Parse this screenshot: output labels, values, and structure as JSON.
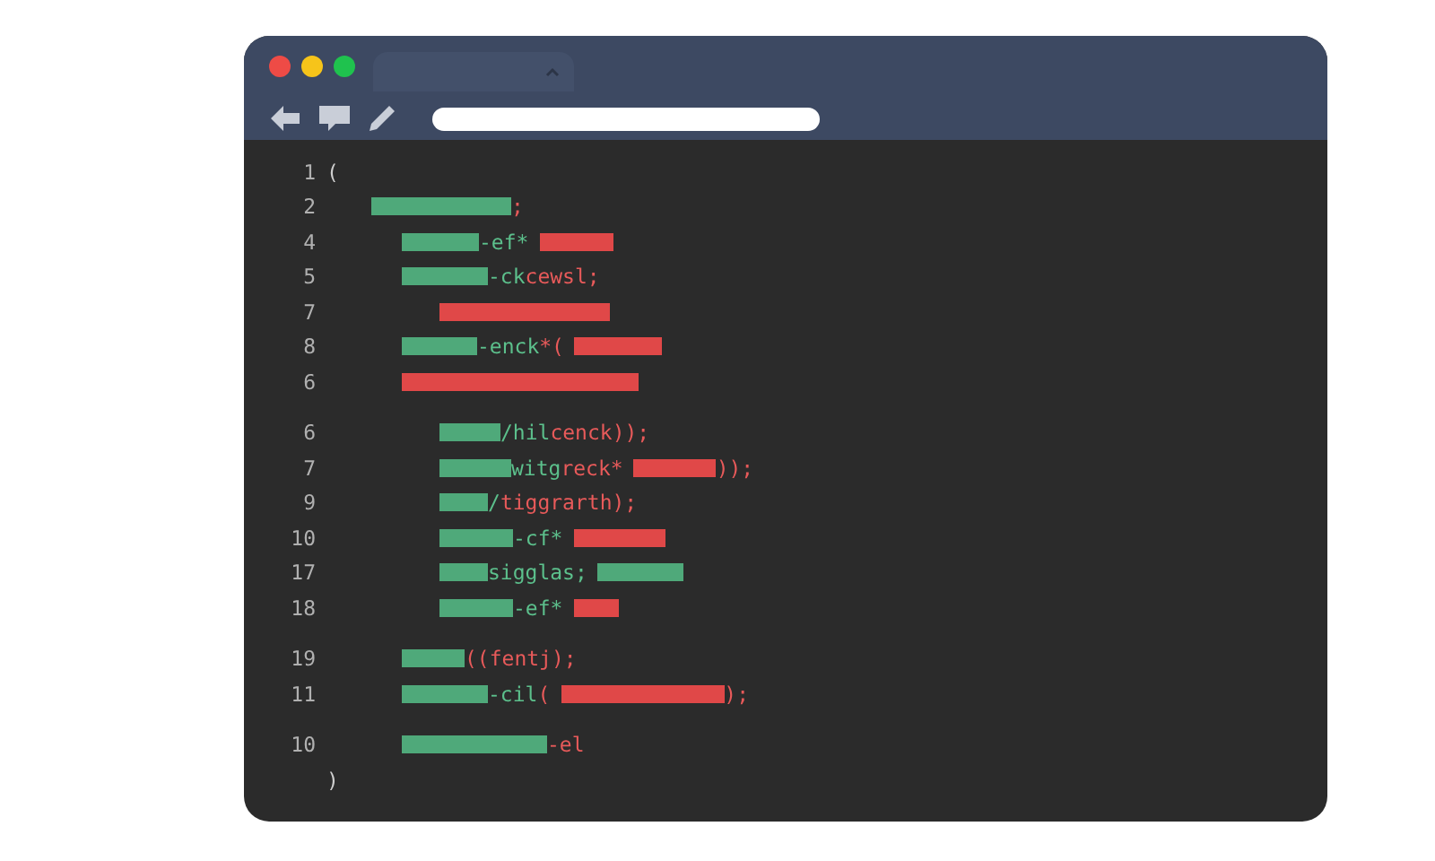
{
  "editor": {
    "lines": [
      {
        "number": "1",
        "parts": [
          {
            "kind": "text",
            "color": "#cfcfcf",
            "text": "("
          }
        ]
      },
      {
        "number": "2",
        "parts": [
          {
            "kind": "bar",
            "color": "#4fa97a"
          },
          {
            "kind": "text",
            "color": "#e85a5a",
            "text": ";"
          }
        ]
      },
      {
        "number": "4",
        "parts": [
          {
            "kind": "bar",
            "color": "#4fa97a"
          },
          {
            "kind": "text",
            "color": "#5cc08c",
            "text": "-ef*"
          },
          {
            "kind": "bar",
            "color": "#e04848"
          }
        ]
      },
      {
        "number": "5",
        "parts": [
          {
            "kind": "bar",
            "color": "#4fa97a"
          },
          {
            "kind": "text",
            "color": "#5cc08c",
            "text": "-ck"
          },
          {
            "kind": "text",
            "color": "#e85a5a",
            "text": "cewsl;"
          }
        ]
      },
      {
        "number": "7",
        "parts": [
          {
            "kind": "bar",
            "color": "#e04848"
          }
        ]
      },
      {
        "number": "8",
        "parts": [
          {
            "kind": "bar",
            "color": "#4fa97a"
          },
          {
            "kind": "text",
            "color": "#5cc08c",
            "text": "-enck"
          },
          {
            "kind": "text",
            "color": "#e85a5a",
            "text": "*("
          },
          {
            "kind": "bar",
            "color": "#e04848"
          }
        ]
      },
      {
        "number": "6",
        "parts": [
          {
            "kind": "bar",
            "color": "#e04848"
          }
        ]
      },
      {
        "number": "6",
        "parts": [
          {
            "kind": "bar",
            "color": "#4fa97a"
          },
          {
            "kind": "text",
            "color": "#5cc08c",
            "text": "/hil"
          },
          {
            "kind": "text",
            "color": "#e85a5a",
            "text": "cenck));"
          }
        ]
      },
      {
        "number": "7",
        "parts": [
          {
            "kind": "bar",
            "color": "#4fa97a"
          },
          {
            "kind": "text",
            "color": "#5cc08c",
            "text": "witg"
          },
          {
            "kind": "text",
            "color": "#e85a5a",
            "text": "reck*"
          },
          {
            "kind": "bar",
            "color": "#e04848"
          },
          {
            "kind": "text",
            "color": "#e85a5a",
            "text": "));"
          }
        ]
      },
      {
        "number": "9",
        "parts": [
          {
            "kind": "bar",
            "color": "#4fa97a"
          },
          {
            "kind": "text",
            "color": "#5cc08c",
            "text": "/"
          },
          {
            "kind": "text",
            "color": "#e85a5a",
            "text": "tiggrarth);"
          }
        ]
      },
      {
        "number": "10",
        "parts": [
          {
            "kind": "bar",
            "color": "#4fa97a"
          },
          {
            "kind": "text",
            "color": "#5cc08c",
            "text": "-cf*"
          },
          {
            "kind": "bar",
            "color": "#e04848"
          }
        ]
      },
      {
        "number": "17",
        "parts": [
          {
            "kind": "bar",
            "color": "#4fa97a"
          },
          {
            "kind": "text",
            "color": "#5cc08c",
            "text": "sigglas;"
          },
          {
            "kind": "bar",
            "color": "#4fa97a"
          }
        ]
      },
      {
        "number": "18",
        "parts": [
          {
            "kind": "bar",
            "color": "#4fa97a"
          },
          {
            "kind": "text",
            "color": "#5cc08c",
            "text": "-ef*"
          },
          {
            "kind": "bar",
            "color": "#e04848"
          }
        ]
      },
      {
        "number": "19",
        "parts": [
          {
            "kind": "bar",
            "color": "#4fa97a"
          },
          {
            "kind": "text",
            "color": "#e85a5a",
            "text": "((fentj);"
          }
        ]
      },
      {
        "number": "11",
        "parts": [
          {
            "kind": "bar",
            "color": "#4fa97a"
          },
          {
            "kind": "text",
            "color": "#5cc08c",
            "text": "-cil"
          },
          {
            "kind": "text",
            "color": "#e85a5a",
            "text": "("
          },
          {
            "kind": "bar",
            "color": "#e04848"
          },
          {
            "kind": "text",
            "color": "#e85a5a",
            "text": ");"
          }
        ]
      },
      {
        "number": "10",
        "parts": [
          {
            "kind": "bar",
            "color": "#4fa97a"
          },
          {
            "kind": "text",
            "color": "#e85a5a",
            "text": "-el"
          }
        ]
      },
      {
        "parts": [
          {
            "kind": "text",
            "color": "#cfcfcf",
            "text": ")"
          }
        ]
      }
    ]
  }
}
